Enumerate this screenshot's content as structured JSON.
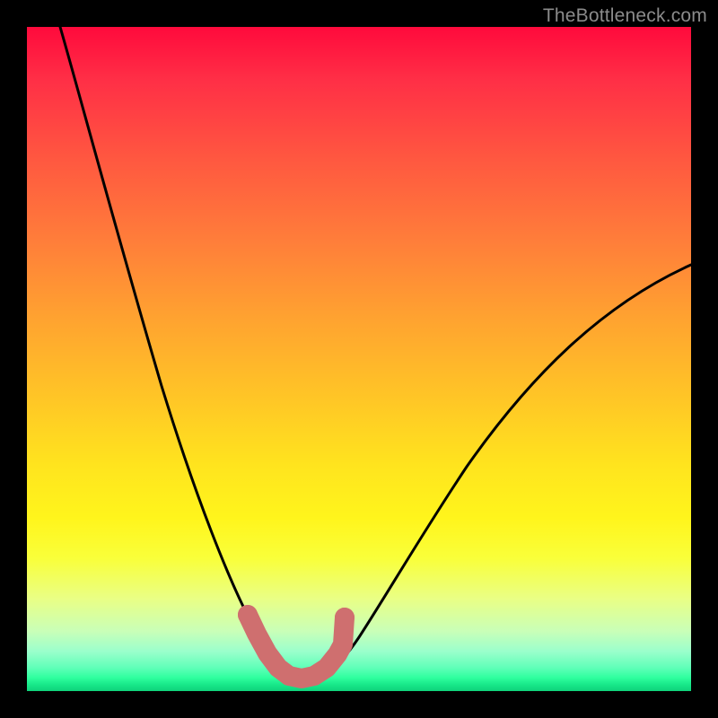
{
  "watermark": "TheBottleneck.com",
  "chart_data": {
    "type": "line",
    "title": "",
    "xlabel": "",
    "ylabel": "",
    "xlim": [
      0,
      100
    ],
    "ylim": [
      0,
      100
    ],
    "grid": false,
    "series": [
      {
        "name": "bottleneck-curve",
        "color": "#000000",
        "x": [
          5,
          10,
          15,
          20,
          25,
          30,
          33,
          35,
          37,
          39,
          41,
          43,
          47,
          52,
          58,
          64,
          70,
          78,
          86,
          94,
          100
        ],
        "y": [
          100,
          84,
          68,
          53,
          38,
          24,
          15,
          10,
          6,
          3.5,
          2.5,
          2.6,
          4,
          8,
          15,
          23,
          31,
          41,
          50,
          58,
          64
        ]
      },
      {
        "name": "highlight-band",
        "color": "#cf6f6f",
        "x": [
          33,
          35,
          37,
          39,
          41,
          43,
          45,
          47
        ],
        "y": [
          10,
          6,
          3.5,
          2.5,
          2.5,
          2.6,
          3.2,
          4
        ]
      }
    ],
    "background_gradient": {
      "top": "#ff0a3c",
      "mid": "#ffe41e",
      "bottom": "#18e98a"
    }
  }
}
